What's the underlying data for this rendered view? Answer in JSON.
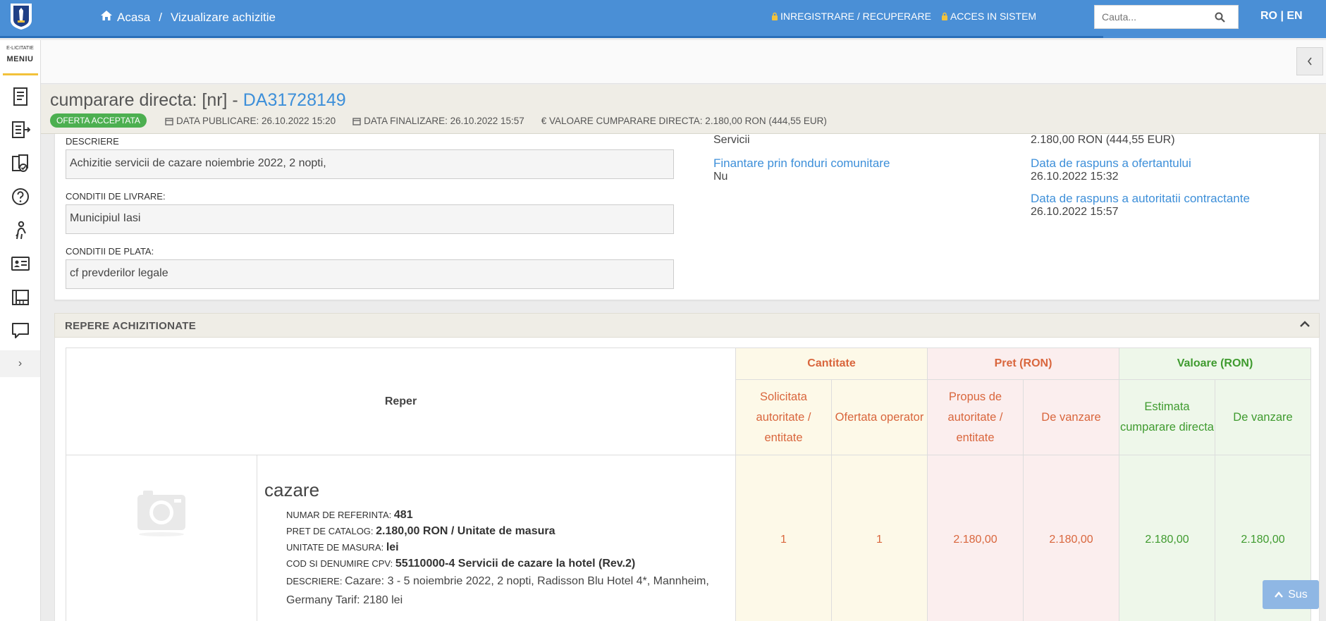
{
  "nav": {
    "home": "Acasa",
    "current": "Vizualizare achizitie",
    "register": "INREGISTRARE / RECUPERARE",
    "login": "ACCES IN SISTEM",
    "search_placeholder": "Cauta...",
    "lang": "RO | EN"
  },
  "sidebar": {
    "brand": "E-LICITATIE",
    "menu": "MENIU",
    "icons": [
      "notepad-icon",
      "list-export-icon",
      "document-check-icon",
      "help-circle-icon",
      "person-icon",
      "id-card-icon",
      "catalog-icon",
      "chat-bubble-icon"
    ],
    "expand": "›"
  },
  "header": {
    "title_prefix": "cumparare directa: [nr] - ",
    "number": "DA31728149",
    "status": "OFERTA ACCEPTATA",
    "publish": "DATA PUBLICARE: 26.10.2022 15:20",
    "finalize": "DATA FINALIZARE: 26.10.2022 15:57",
    "value": "€ VALOARE CUMPARARE DIRECTA: 2.180,00  RON (444,55  EUR)"
  },
  "details": {
    "desc_label": "DESCRIERE",
    "desc_value": "Achizitie servicii de cazare noiembrie 2022, 2 nopti,",
    "delivery_label": "CONDITII DE LIVRARE:",
    "delivery_value": "Municipiul Iasi",
    "payment_label": "CONDITII DE PLATA:",
    "payment_value": "cf prevderilor legale",
    "type_value": "Servicii",
    "eu_funds_label": "Finantare prin fonduri comunitare",
    "eu_funds_value": "Nu",
    "amount_value": "2.180,00  RON (444,55  EUR)",
    "bidder_response_label": "Data de raspuns a ofertantului",
    "bidder_response_value": "26.10.2022 15:32",
    "authority_response_label": "Data de raspuns a autoritatii contractante",
    "authority_response_value": "26.10.2022 15:57"
  },
  "repere": {
    "title": "REPERE ACHIZITIONATE",
    "col_reper": "Reper",
    "group_cantitate": "Cantitate",
    "group_pret": "Pret (RON)",
    "group_valoare": "Valoare (RON)",
    "sub": [
      "Solicitata autoritate / entitate",
      "Ofertata operator",
      "Propus de autoritate / entitate",
      "De vanzare",
      "Estimata cumparare directa",
      "De vanzare"
    ],
    "item": {
      "name": "cazare",
      "ref_label": "NUMAR DE REFERINTA:",
      "ref_value": "481",
      "catalog_label": "PRET DE CATALOG:",
      "catalog_value": "2.180,00  RON / Unitate de masura",
      "unit_label": "UNITATE DE MASURA:",
      "unit_value": "lei",
      "cpv_label": "COD SI DENUMIRE CPV:",
      "cpv_value": "55110000-4 Servicii de cazare la hotel (Rev.2)",
      "desc_label": "DESCRIERE:",
      "desc_value": "Cazare: 3 - 5 noiembrie 2022, 2 nopti, Radisson Blu Hotel 4*, Mannheim, Germany Tarif: 2180 lei",
      "values": [
        "1",
        "1",
        "2.180,00",
        "2.180,00",
        "2.180,00",
        "2.180,00"
      ]
    }
  },
  "back_to_top": "Sus"
}
